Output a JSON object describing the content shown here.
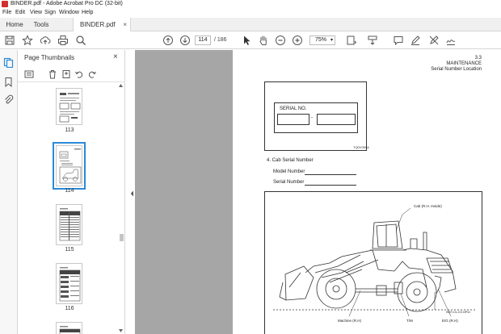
{
  "window": {
    "title": "BINDER.pdf - Adobe Acrobat Pro DC (32-bit)"
  },
  "menu": [
    "File",
    "Edit",
    "View",
    "Sign",
    "Window",
    "Help"
  ],
  "tabs": {
    "home": "Home",
    "tools": "Tools",
    "document": "BINDER.pdf",
    "close": "×"
  },
  "toolbar": {
    "current_page": "114",
    "page_count": "/ 186",
    "zoom": "75%",
    "icons": [
      "save-icon",
      "bookmark-star-icon",
      "cloud-upload-icon",
      "print-icon",
      "search-icon",
      "page-up-icon",
      "page-down-icon",
      "select-cursor-icon",
      "hand-icon",
      "zoom-out-icon",
      "zoom-in-icon",
      "page-fit-icon",
      "scroll-mode-icon",
      "comment-icon",
      "highlight-pen-icon",
      "clear-pen-icon",
      "sign-icon"
    ]
  },
  "thumbnails": {
    "title": "Page Thumbnails",
    "close": "×",
    "pages": [
      {
        "label": "113",
        "selected": false
      },
      {
        "label": "114",
        "selected": true
      },
      {
        "label": "115",
        "selected": false
      },
      {
        "label": "116",
        "selected": false
      },
      {
        "label": "",
        "selected": false
      }
    ]
  },
  "page": {
    "section": "3.3",
    "chapter": "MAINTENANCE",
    "subtitle": "Serial Number Location",
    "plate_label": "SERIAL NO.",
    "plate_dash": "-",
    "plate_code": "TQ0V059A",
    "cab_heading": "4.  Cab Serial Number",
    "model_label": "Model Number",
    "serial_label": "Serial Number",
    "callouts": {
      "cab": "Cab (R.H. Inside)",
      "machine": "Machine (R.H)",
      "tm": "T/M",
      "eg": "E/G (R.H)",
      "small": "INSY-OL-CO-NP41"
    }
  },
  "colors": {
    "accent": "#2b8ad6",
    "pdf_red": "#d32f2f",
    "gray_bg": "#a6a6a6"
  }
}
